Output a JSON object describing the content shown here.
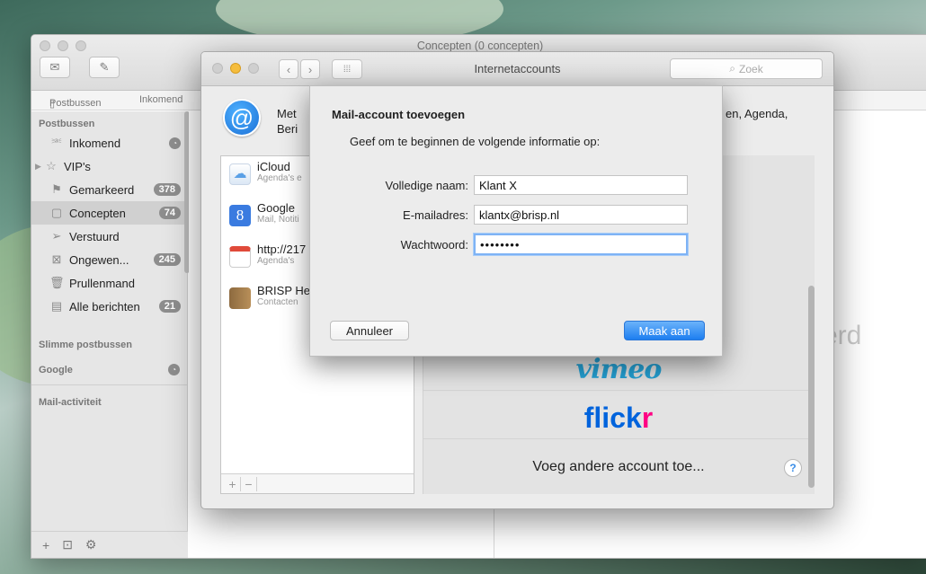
{
  "mail": {
    "title": "Concepten (0 concepten)",
    "tabs": {
      "mailboxes": "Postbussen",
      "inbox": "Inkomend"
    },
    "sidebar": {
      "section_mailboxes": "Postbussen",
      "items": [
        {
          "label": "Inkomend",
          "icon": "inbox-icon"
        },
        {
          "label": "VIP's",
          "icon": "star-icon"
        },
        {
          "label": "Gemarkeerd",
          "badge": "378",
          "icon": "flag-icon"
        },
        {
          "label": "Concepten",
          "badge": "74",
          "icon": "document-icon"
        },
        {
          "label": "Verstuurd",
          "icon": "paperplane-icon"
        },
        {
          "label": "Ongewen...",
          "badge": "245",
          "icon": "junk-icon"
        },
        {
          "label": "Prullenmand",
          "icon": "trash-icon"
        },
        {
          "label": "Alle berichten",
          "badge": "21",
          "icon": "archive-icon"
        }
      ],
      "section_smart": "Slimme postbussen",
      "section_google": "Google",
      "section_activity": "Mail-activiteit"
    },
    "right_text": "erd"
  },
  "prefs": {
    "title": "Internetaccounts",
    "search_placeholder": "Zoek",
    "intro_left": "Met",
    "intro_left2": "Beri",
    "intro_right": "en, Agenda,",
    "accounts": [
      {
        "name": "iCloud",
        "sub": "Agenda's e",
        "icon": "icloud-icon"
      },
      {
        "name": "Google",
        "sub": "Mail, Notiti",
        "icon": "google-icon"
      },
      {
        "name": "http://217",
        "sub": "Agenda's",
        "icon": "calendar-icon"
      },
      {
        "name": "BRISP He",
        "sub": "Contacten",
        "icon": "contacts-icon"
      }
    ],
    "providers": {
      "vimeo": "vimeo",
      "flickr": "flickr",
      "other": "Voeg andere account toe..."
    }
  },
  "sheet": {
    "title": "Mail-account toevoegen",
    "description": "Geef om te beginnen de volgende informatie op:",
    "name_label": "Volledige naam:",
    "name_value": "Klant X",
    "email_label": "E-mailadres:",
    "email_value": "klantx@brisp.nl",
    "password_label": "Wachtwoord:",
    "password_value": "••••••••",
    "cancel_label": "Annuleer",
    "create_label": "Maak aan"
  }
}
